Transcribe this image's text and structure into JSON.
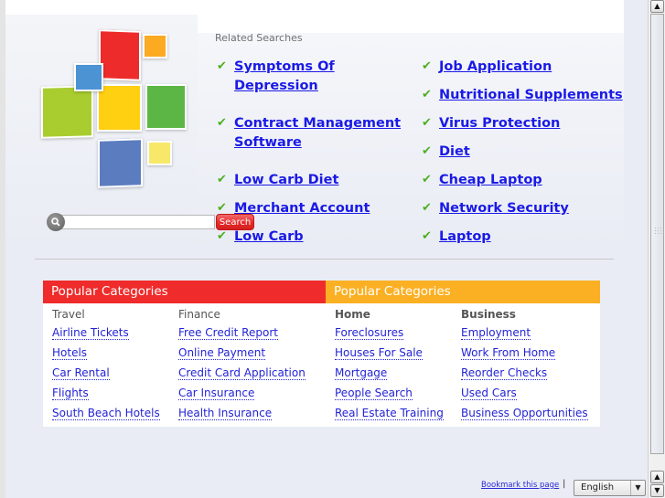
{
  "search": {
    "placeholder": "",
    "value": "",
    "button_label": "Search",
    "icon": "magnifier-icon"
  },
  "related": {
    "title": "Related Searches",
    "icon": "checkmark-icon",
    "column1": [
      {
        "label": "Symptoms Of Depression"
      },
      {
        "label": "Contract Management Software"
      },
      {
        "label": "Low Carb Diet"
      },
      {
        "label": "Merchant Account"
      },
      {
        "label": "Low Carb"
      }
    ],
    "column2": [
      {
        "label": "Job Application"
      },
      {
        "label": "Nutritional Supplements"
      },
      {
        "label": "Virus Protection"
      },
      {
        "label": "Diet"
      },
      {
        "label": "Cheap Laptop"
      },
      {
        "label": "Network Security"
      },
      {
        "label": "Laptop"
      }
    ]
  },
  "categories": [
    {
      "header": "Popular Categories",
      "color": "#ef2b2b",
      "columns": [
        {
          "title": "Travel",
          "links": [
            "Airline Tickets",
            "Hotels",
            "Car Rental",
            "Flights",
            "South Beach Hotels"
          ]
        },
        {
          "title": "Finance",
          "links": [
            "Free Credit Report",
            "Online Payment",
            "Credit Card Application",
            "Car Insurance",
            "Health Insurance"
          ]
        }
      ]
    },
    {
      "header": "Popular Categories",
      "color": "#fbb024",
      "columns": [
        {
          "title": "Home",
          "links": [
            "Foreclosures",
            "Houses For Sale",
            "Mortgage",
            "People Search",
            "Real Estate Training"
          ]
        },
        {
          "title": "Business",
          "links": [
            "Employment",
            "Work From Home",
            "Reorder Checks",
            "Used Cars",
            "Business Opportunities"
          ]
        }
      ]
    }
  ],
  "footer": {
    "bookmark_label": "Bookmark this page",
    "separator": "|",
    "language_selected": "English"
  },
  "colors": {
    "link": "#1a1ae6",
    "check": "#4caf1f",
    "accent_red": "#ef2b2b",
    "accent_orange": "#fbb024"
  }
}
